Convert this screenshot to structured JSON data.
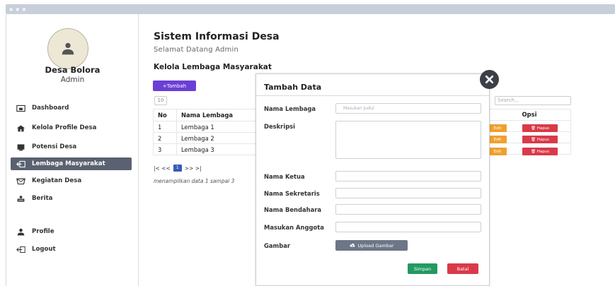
{
  "sidebar": {
    "village_name": "Desa Bolora",
    "role": "Admin",
    "avatar_icon": "user-icon",
    "items": [
      {
        "label": "Dashboard",
        "icon": "dashboard-icon"
      },
      {
        "label": "Kelola Profile Desa",
        "icon": "home-icon"
      },
      {
        "label": "Potensi Desa",
        "icon": "tv-icon"
      },
      {
        "label": "Lembaga Masyarakat",
        "icon": "back-box-icon",
        "active": true
      },
      {
        "label": "Kegiatan Desa",
        "icon": "inbox-icon"
      },
      {
        "label": "Berita",
        "icon": "news-icon"
      },
      {
        "label": "Profile",
        "icon": "user-icon"
      },
      {
        "label": "Logout",
        "icon": "logout-icon"
      }
    ],
    "active_color": "#5a6170"
  },
  "header": {
    "title": "Sistem Informasi Desa",
    "subtitle": "Selamat Datang  Admin"
  },
  "main": {
    "section_title": "Kelola Lembaga Masyarakat",
    "add_button": "+Tambah",
    "add_button_color": "#6b3fd6",
    "entries_select": "10",
    "search_placeholder": "Search...",
    "table": {
      "columns": [
        "No",
        "Nama Lembaga"
      ],
      "options_column": "Opsi",
      "rows": [
        {
          "no": "1",
          "name": "Lembaga 1"
        },
        {
          "no": "2",
          "name": "Lembaga 2"
        },
        {
          "no": "3",
          "name": "Lembaga 3"
        }
      ],
      "edit_label": "Edit",
      "delete_label": "Hapus"
    },
    "pagination": {
      "first": "|<",
      "prev": "<<",
      "current": "1",
      "next": ">>",
      "last": ">|"
    },
    "footnote": "menampilkan data 1 sampai 3"
  },
  "modal": {
    "title": "Tambah Data",
    "fields": {
      "nama_lembaga": {
        "label": "Nama Lembaga",
        "placeholder": "Masukan Judul"
      },
      "deskripsi": {
        "label": "Deskripsi"
      },
      "nama_ketua": {
        "label": "Nama Ketua"
      },
      "nama_sekretaris": {
        "label": "Nama Sekretaris"
      },
      "nama_bendahara": {
        "label": "Nama Bendahara"
      },
      "masukan_anggota": {
        "label": "Masukan Anggota"
      },
      "gambar": {
        "label": "Gambar"
      }
    },
    "upload_button": "Upload Gambar",
    "save_button": "Simpan",
    "cancel_button": "Batal",
    "colors": {
      "upload": "#6c7686",
      "save": "#239a62",
      "cancel": "#d93a4a",
      "close": "#3b3f47"
    }
  }
}
